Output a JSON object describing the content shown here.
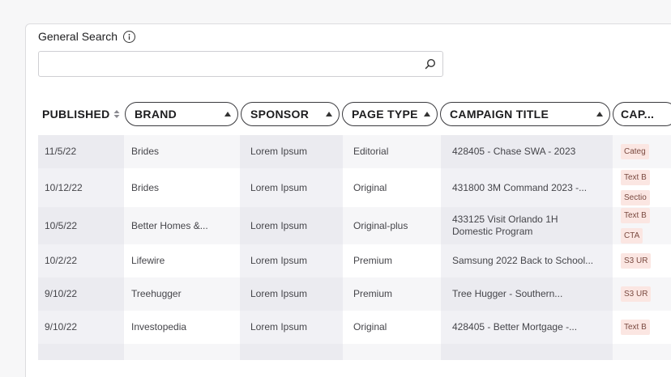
{
  "search": {
    "label": "General Search",
    "value": "",
    "placeholder": ""
  },
  "table": {
    "columns": {
      "published": "PUBLISHED",
      "brand": "BRAND",
      "sponsor": "SPONSOR",
      "page_type": "PAGE TYPE",
      "campaign_title": "CAMPAIGN TITLE",
      "cap": "CAP..."
    },
    "rows": [
      {
        "published": "11/5/22",
        "brand": "Brides",
        "sponsor": "Lorem Ipsum",
        "page_type": "Editorial",
        "campaign_title": "428405 - Chase SWA - 2023",
        "tags": [
          "Categ"
        ]
      },
      {
        "published": "10/12/22",
        "brand": "Brides",
        "sponsor": "Lorem Ipsum",
        "page_type": "Original",
        "campaign_title": "431800 3M Command 2023 -...",
        "tags": [
          "Text B",
          "Sectio"
        ]
      },
      {
        "published": "10/5/22",
        "brand": "Better Homes &...",
        "sponsor": "Lorem Ipsum",
        "page_type": "Original-plus",
        "campaign_title": "433125 Visit Orlando 1H Domestic Program",
        "tags": [
          "Text B",
          "CTA"
        ]
      },
      {
        "published": "10/2/22",
        "brand": "Lifewire",
        "sponsor": "Lorem Ipsum",
        "page_type": "Premium",
        "campaign_title": "Samsung 2022 Back to School...",
        "tags": [
          "S3 UR"
        ]
      },
      {
        "published": "9/10/22",
        "brand": "Treehugger",
        "sponsor": "Lorem Ipsum",
        "page_type": "Premium",
        "campaign_title": "Tree Hugger - Southern...",
        "tags": [
          "S3 UR"
        ]
      },
      {
        "published": "9/10/22",
        "brand": "Investopedia",
        "sponsor": "Lorem Ipsum",
        "page_type": "Original",
        "campaign_title": "428405 - Better Mortgage -...",
        "tags": [
          "Text B"
        ]
      }
    ]
  }
}
